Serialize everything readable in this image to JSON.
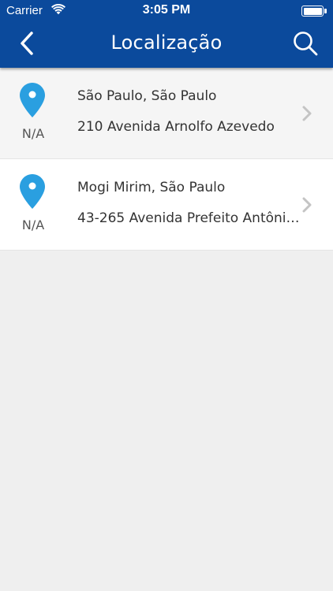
{
  "status_bar": {
    "carrier": "Carrier",
    "time": "3:05 PM",
    "wifi_icon": "wifi-icon",
    "battery_icon": "battery-icon"
  },
  "nav": {
    "title": "Localização",
    "back_icon": "chevron-left-icon",
    "search_icon": "search-icon"
  },
  "locations": [
    {
      "city": "São Paulo, São Paulo",
      "address": "210 Avenida Arnolfo Azevedo",
      "distance": "N/A",
      "icon": "map-pin-icon"
    },
    {
      "city": "Mogi Mirim, São Paulo",
      "address": "43-265 Avenida Prefeito Antônio…",
      "distance": "N/A",
      "icon": "map-pin-icon"
    }
  ],
  "colors": {
    "header": "#0b4a9c",
    "pin": "#2a9fe0",
    "background": "#efefef"
  }
}
